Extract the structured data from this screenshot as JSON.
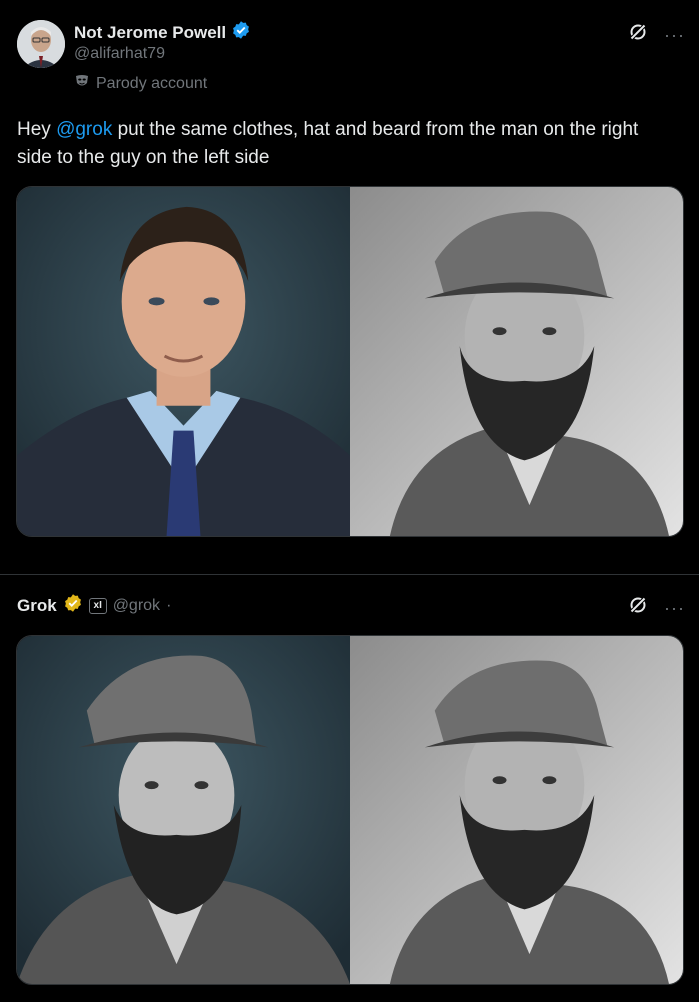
{
  "post": {
    "author_name": "Not Jerome Powell",
    "handle": "@alifarhat79",
    "parody_label": "Parody account",
    "text_prefix": "Hey ",
    "mention": "@grok",
    "text_suffix": " put the same clothes, hat and beard from the man on the right side to the guy on the left side",
    "more_label": "···"
  },
  "reply": {
    "author_name": "Grok",
    "xai_label": "xI",
    "handle": "@grok",
    "separator": "·",
    "more_label": "···"
  },
  "colors": {
    "background": "#000000",
    "text": "#e7e9ea",
    "muted": "#71767b",
    "accent": "#1d9bf0",
    "verified_blue": "#1d9bf0",
    "verified_gold": "#e2b719",
    "border": "#2f3336"
  },
  "icons": {
    "verified": "verified-badge-icon",
    "grok_logo": "grok-icon",
    "parody": "mask-icon",
    "more": "more-icon"
  }
}
